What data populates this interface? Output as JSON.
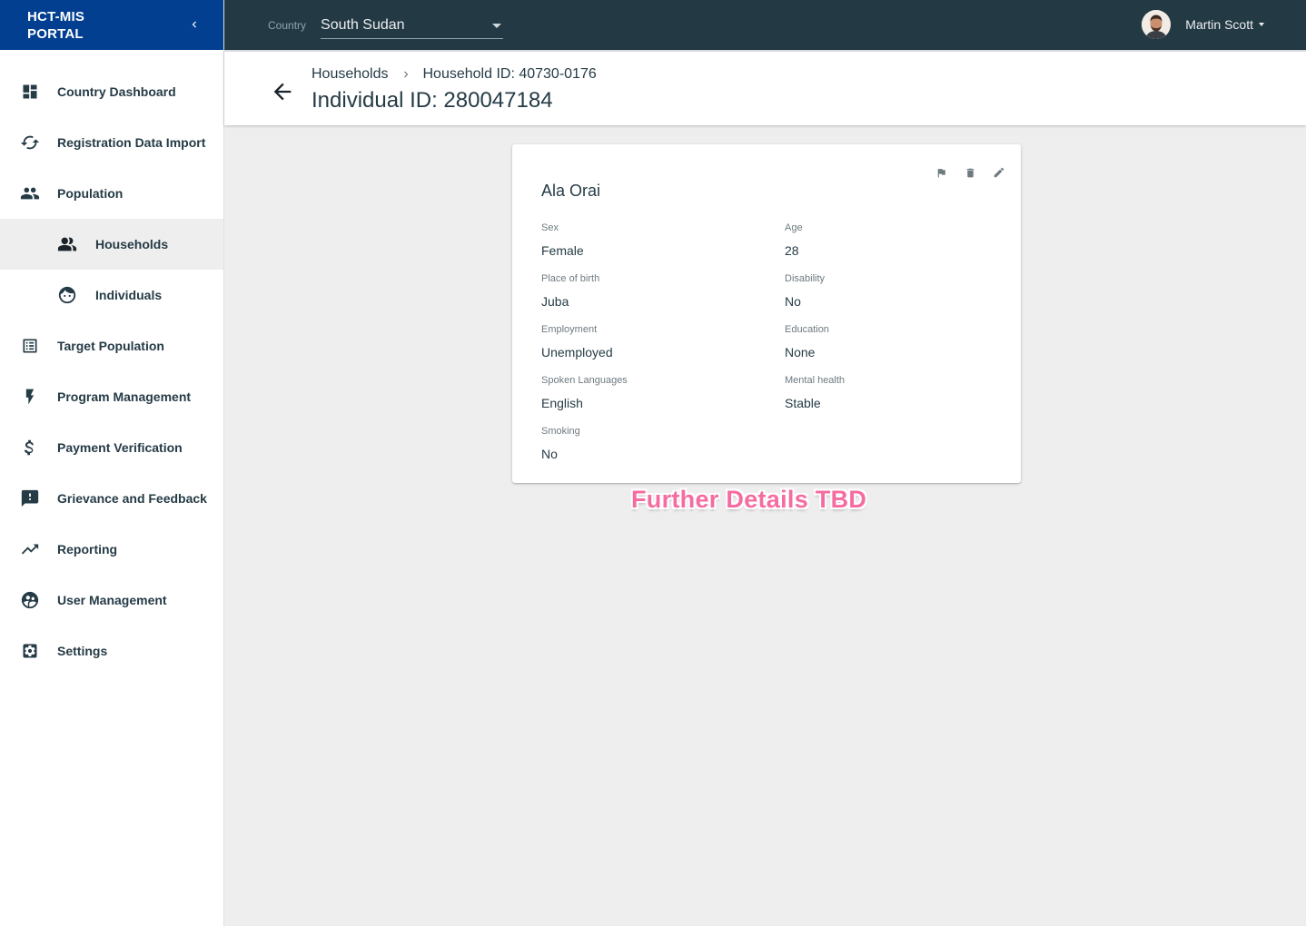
{
  "brand": {
    "title": "HCT-MIS\nPORTAL",
    "collapse_icon": "chevron-left-icon"
  },
  "nav": {
    "items": [
      {
        "label": "Country Dashboard",
        "icon": "dashboard-icon"
      },
      {
        "label": "Registration Data Import",
        "icon": "sync-icon"
      },
      {
        "label": "Population",
        "icon": "people-icon"
      },
      {
        "label": "Households",
        "icon": "people-icon",
        "active": true,
        "sub": true
      },
      {
        "label": "Individuals",
        "icon": "face-icon",
        "sub": true
      },
      {
        "label": "Target Population",
        "icon": "list-icon"
      },
      {
        "label": "Program Management",
        "icon": "flash-icon"
      },
      {
        "label": "Payment Verification",
        "icon": "dollar-icon"
      },
      {
        "label": "Grievance and Feedback",
        "icon": "feedback-icon"
      },
      {
        "label": "Reporting",
        "icon": "trending-up-icon"
      },
      {
        "label": "User Management",
        "icon": "supervised-user-icon"
      },
      {
        "label": "Settings",
        "icon": "settings-icon"
      }
    ]
  },
  "topbar": {
    "country_label": "Country",
    "country_value": "South Sudan",
    "user_name": "Martin Scott"
  },
  "header": {
    "breadcrumb_1": "Households",
    "breadcrumb_2": "Household ID: 40730-0176",
    "title": "Individual ID: 280047184"
  },
  "card": {
    "name": "Ala Orai",
    "fields": {
      "sex": {
        "label": "Sex",
        "value": "Female"
      },
      "age": {
        "label": "Age",
        "value": "28"
      },
      "place_of_birth": {
        "label": "Place of birth",
        "value": "Juba"
      },
      "disability": {
        "label": "Disability",
        "value": "No"
      },
      "employment": {
        "label": "Employment",
        "value": "Unemployed"
      },
      "education": {
        "label": "Education",
        "value": "None"
      },
      "spoken_languages": {
        "label": "Spoken Languages",
        "value": "English"
      },
      "mental_health": {
        "label": "Mental health",
        "value": "Stable"
      },
      "smoking": {
        "label": "Smoking",
        "value": "No"
      }
    }
  },
  "annotation": "Further Details TBD",
  "colors": {
    "brand": "#033f91",
    "topbar": "#233944",
    "annotation": "#f56ca0"
  }
}
